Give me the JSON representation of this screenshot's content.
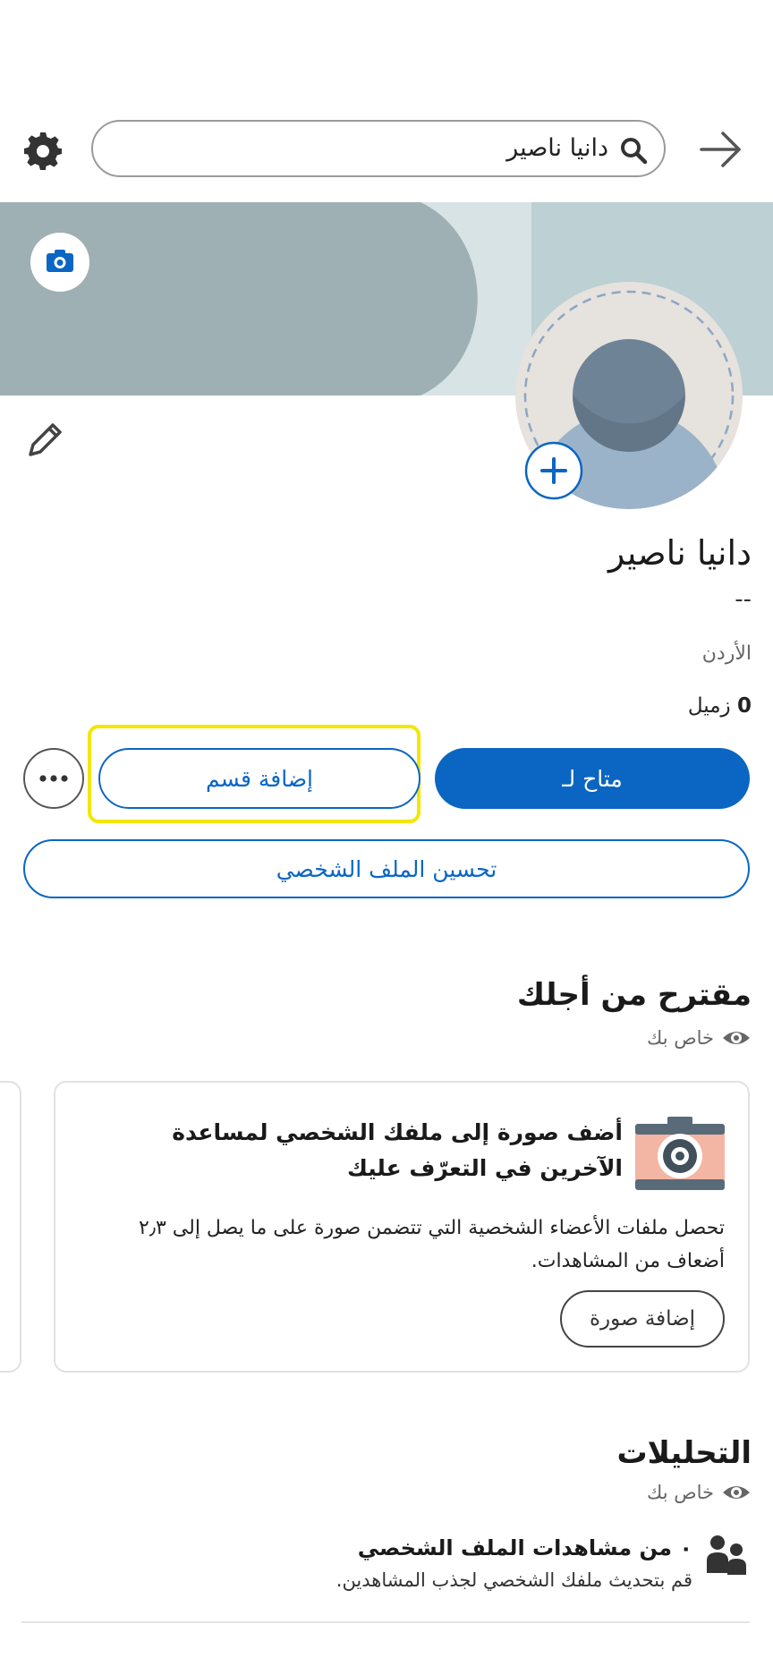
{
  "search": {
    "value": "دانيا ناصير"
  },
  "profile": {
    "name": "دانيا ناصير",
    "headline": "--",
    "location": "الأردن",
    "connections_count": "0",
    "connections_label": " زميل"
  },
  "actions": {
    "available_for": "متاح لـ",
    "add_section": "إضافة قسم",
    "improve_profile": "تحسين الملف الشخصي"
  },
  "suggested": {
    "title": "مقترح من أجلك",
    "private": "خاص بك",
    "card": {
      "title": "أضف صورة إلى ملفك الشخصي لمساعدة الآخرين في التعرّف عليك",
      "description": "تحصل ملفات الأعضاء الشخصية التي تتضمن صورة على ما يصل إلى ٢٫٣ أضعاف من المشاهدات.",
      "button": "إضافة صورة"
    }
  },
  "analytics": {
    "title": "التحليلات",
    "private": "خاص بك",
    "views_title": "٠ من مشاهدات الملف الشخصي",
    "views_sub": "قم بتحديث ملفك الشخصي لجذب المشاهدين."
  },
  "colors": {
    "accent": "#0a66c2",
    "highlight": "#f3e600",
    "cover_dark": "#9eb0b3",
    "cover_light": "#bdd0d3"
  },
  "icons": [
    "gear-icon",
    "search-icon",
    "back-arrow-icon",
    "camera-icon",
    "pencil-icon",
    "plus-icon",
    "more-icon",
    "eye-icon",
    "people-icon"
  ]
}
